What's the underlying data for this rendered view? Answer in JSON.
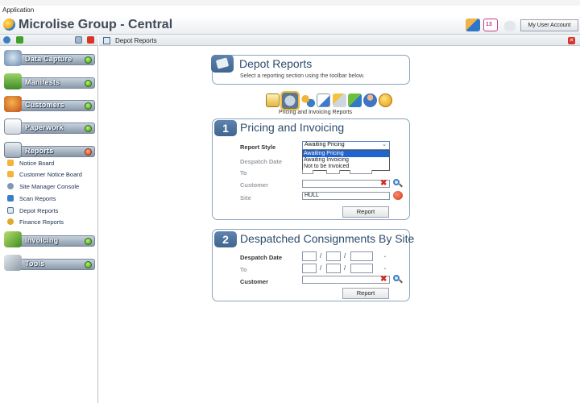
{
  "app": {
    "title": "Application",
    "brand": "Microlise Group - Central",
    "account_button": "My User Account"
  },
  "header_icons": [
    "users-icon",
    "calendar-icon",
    "cloud-icon"
  ],
  "calendar_badge": "13",
  "sidebar": {
    "sections": [
      {
        "label": "Data Capture",
        "icon": "data-capture-icon"
      },
      {
        "label": "Manifests",
        "icon": "manifests-icon"
      },
      {
        "label": "Customers",
        "icon": "customers-icon"
      },
      {
        "label": "Paperwork",
        "icon": "paperwork-icon"
      },
      {
        "label": "Reports",
        "icon": "reports-icon"
      },
      {
        "label": "Invoicing",
        "icon": "invoicing-icon"
      },
      {
        "label": "Tools",
        "icon": "tools-icon"
      }
    ],
    "report_items": [
      {
        "label": "Notice Board",
        "icon": "notice-board-icon"
      },
      {
        "label": "Customer Notice Board",
        "icon": "customer-notice-icon"
      },
      {
        "label": "Site Manager Console",
        "icon": "site-manager-icon"
      },
      {
        "label": "Scan Reports",
        "icon": "scan-reports-icon"
      },
      {
        "label": "Depot Reports",
        "icon": "depot-reports-icon"
      },
      {
        "label": "Finance Reports",
        "icon": "finance-reports-icon"
      }
    ]
  },
  "tab": {
    "title": "Depot Reports"
  },
  "intro": {
    "title": "Depot Reports",
    "subtitle": "Select a reporting section using the toolbar below."
  },
  "toolbar": {
    "caption": "Pricing and Invoicing Reports"
  },
  "section1": {
    "number": "1",
    "title": "Pricing and Invoicing",
    "report_style_label": "Report Style",
    "report_style_value": "Awaiting Pricing",
    "options": [
      "Awaiting Pricing",
      "Awaiting Invoicing",
      "Not to be Invoiced"
    ],
    "despatch_label": "Despatch Date",
    "to_label": "To",
    "customer_label": "Customer",
    "site_label": "Site",
    "site_value": "HULL",
    "report_button": "Report"
  },
  "section2": {
    "number": "2",
    "title": "Despatched Consignments By Site",
    "despatch_label": "Despatch Date",
    "to_label": "To",
    "customer_label": "Customer",
    "report_button": "Report"
  },
  "colors": {
    "accent": "#3f6590",
    "panel_border": "#8aa4be",
    "dropdown_highlight": "#1e64d2"
  }
}
